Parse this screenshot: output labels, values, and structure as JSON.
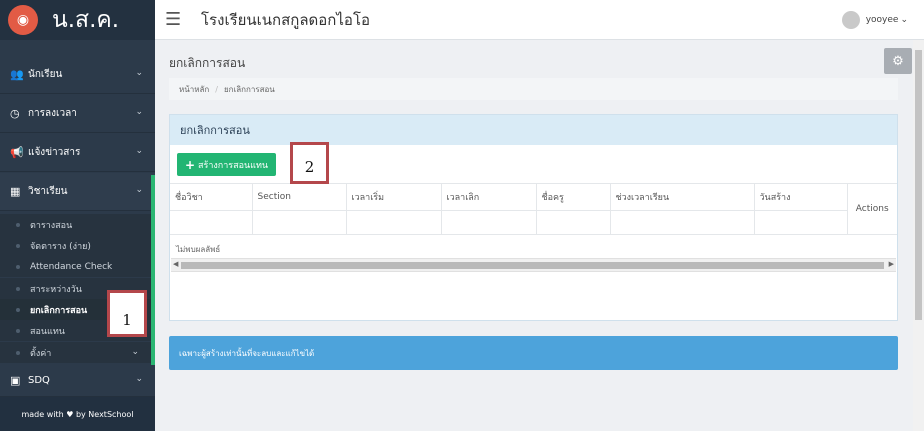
{
  "sidebar": {
    "brand": "น.ส.ค.",
    "menu": [
      {
        "label": "นักเรียน",
        "icon": "users-icon"
      },
      {
        "label": "การลงเวลา",
        "icon": "clock-icon"
      },
      {
        "label": "แจ้งข่าวสาร",
        "icon": "megaphone-icon"
      },
      {
        "label": "วิชาเรียน",
        "icon": "calendar-icon"
      }
    ],
    "submenu": [
      {
        "label": "ตารางสอน"
      },
      {
        "label": "จัดตาราง (ง่าย)"
      },
      {
        "label": "Attendance Check"
      },
      {
        "label": "สาระหว่างวัน"
      },
      {
        "label": "ยกเลิกการสอน"
      },
      {
        "label": "สอนแทน"
      },
      {
        "label": "ตั้งค่า"
      }
    ],
    "sdq": "SDQ",
    "footer": "made with ♥ by NextSchool"
  },
  "topbar": {
    "school": "โรงเรียนเนกสกูลดอกไอโอ",
    "user": "yooyee"
  },
  "page": {
    "title": "ยกเลิกการสอน",
    "breadcrumb": [
      "หน้าหลัก",
      "ยกเลิกการสอน"
    ]
  },
  "panel": {
    "title": "ยกเลิกการสอน",
    "create_button": "สร้างการสอนแทน",
    "columns": [
      "ชื่อวิชา",
      "Section",
      "เวลาเริ่ม",
      "เวลาเลิก",
      "ชื่อครู",
      "ช่วงเวลาเรียน",
      "วันสร้าง",
      "Actions"
    ],
    "no_result": "ไม่พบผลลัพธ์"
  },
  "info": "เฉพาะผู้สร้างเท่านั้นที่จะลบและแก้ไขได้",
  "callouts": {
    "one": "1",
    "two": "2"
  }
}
